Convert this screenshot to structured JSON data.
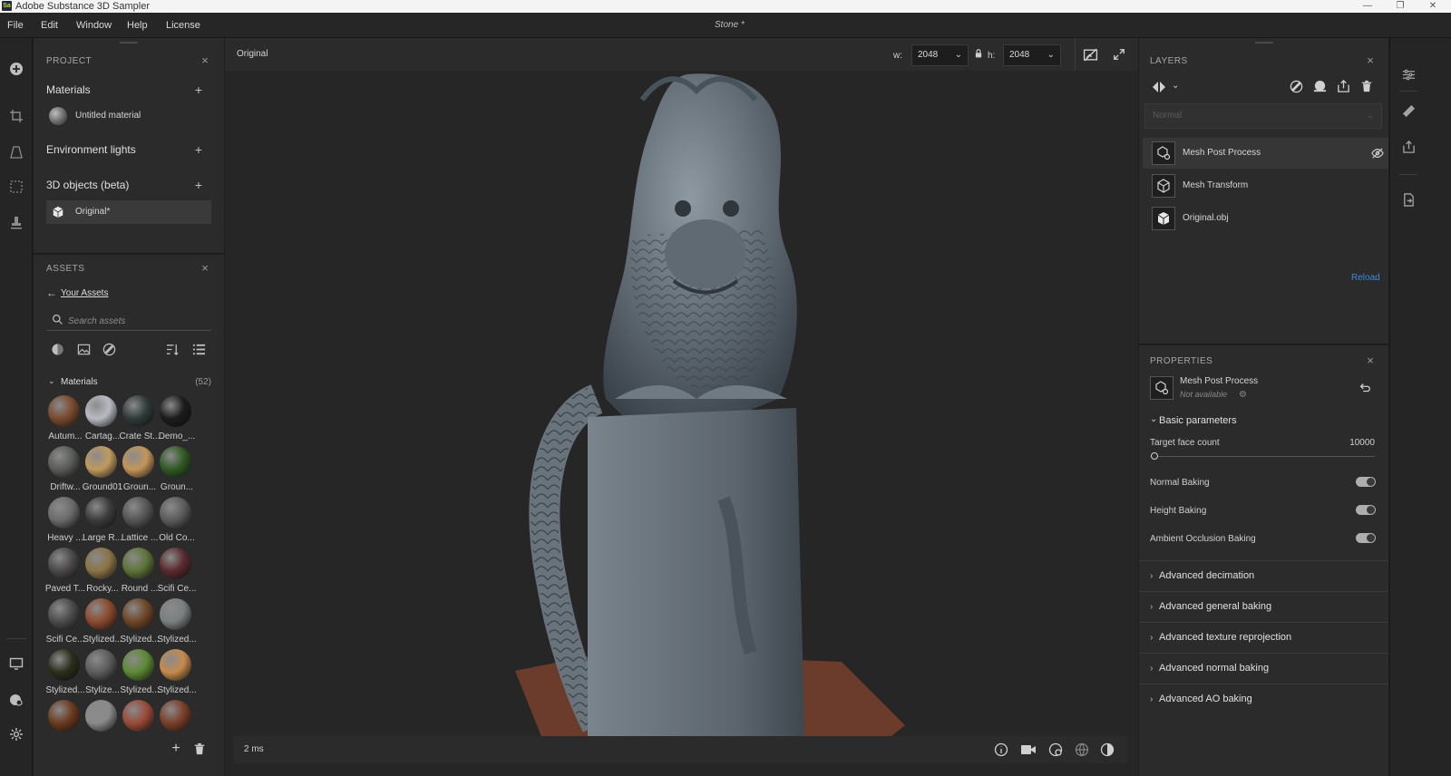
{
  "titlebar": {
    "app_icon": "Sa",
    "title": "Adobe Substance 3D Sampler",
    "min": "—",
    "max": "❐",
    "close": "✕"
  },
  "menu": [
    "File",
    "Edit",
    "Window",
    "Help",
    "License"
  ],
  "document_title": "Stone *",
  "project": {
    "title": "PROJECT",
    "materials_header": "Materials",
    "material_item": "Untitled material",
    "env_header": "Environment lights",
    "objects_header": "3D objects (beta)",
    "object_item": "Original*"
  },
  "assets": {
    "title": "ASSETS",
    "back_label": "Your Assets",
    "search_placeholder": "Search assets",
    "group_label": "Materials",
    "group_count": "(52)",
    "materials": [
      {
        "name": "Autum...",
        "color": "#7a4a2e"
      },
      {
        "name": "Cartag...",
        "color": "#b8bcc2"
      },
      {
        "name": "Crate St...",
        "color": "#2f3b3a"
      },
      {
        "name": "Demo_...",
        "color": "#1c1c1c"
      },
      {
        "name": "Driftw...",
        "color": "#5a5c59"
      },
      {
        "name": "Ground01",
        "color": "#c09a5e"
      },
      {
        "name": "Groun...",
        "color": "#c4955a"
      },
      {
        "name": "Groun...",
        "color": "#2f5a24"
      },
      {
        "name": "Heavy ...",
        "color": "#6b6b6b"
      },
      {
        "name": "Large R...",
        "color": "#3c3c3c"
      },
      {
        "name": "Lattice ...",
        "color": "#555555"
      },
      {
        "name": "Old Co...",
        "color": "#5c5c5c"
      },
      {
        "name": "Paved T...",
        "color": "#4a4848"
      },
      {
        "name": "Rocky...",
        "color": "#8a7346"
      },
      {
        "name": "Round ...",
        "color": "#5d7438"
      },
      {
        "name": "Scifi Ce...",
        "color": "#5a2a2e"
      },
      {
        "name": "Scifi Ce...",
        "color": "#4b4b4b"
      },
      {
        "name": "Stylized...",
        "color": "#8c4a2e"
      },
      {
        "name": "Stylized...",
        "color": "#6e4526"
      },
      {
        "name": "Stylized...",
        "color": "#7b7f80"
      },
      {
        "name": "Stylized...",
        "color": "#2a2d1a"
      },
      {
        "name": "Stylize...",
        "color": "#5c5c5c"
      },
      {
        "name": "Stylized...",
        "color": "#5c8a34"
      },
      {
        "name": "Stylized...",
        "color": "#c68a4c"
      },
      {
        "name": "",
        "color": "#6b3a1e"
      },
      {
        "name": "",
        "color": "#8a8a8a"
      },
      {
        "name": "",
        "color": "#9a4a38"
      },
      {
        "name": "",
        "color": "#7a3e2a"
      }
    ]
  },
  "viewport": {
    "label": "Original",
    "w_label": "w:",
    "w_value": "2048",
    "h_label": "h:",
    "h_value": "2048",
    "status": "2 ms"
  },
  "layers": {
    "title": "LAYERS",
    "blend_mode": "Normal",
    "items": [
      {
        "label": "Mesh Post Process"
      },
      {
        "label": "Mesh Transform"
      },
      {
        "label": "Original.obj"
      }
    ],
    "reload": "Reload"
  },
  "properties": {
    "title": "PROPERTIES",
    "node_name": "Mesh Post Process",
    "node_status": "Not available",
    "basic_header": "Basic parameters",
    "target_face_label": "Target face count",
    "target_face_value": "10000",
    "target_face_fraction": 0.02,
    "toggles": [
      {
        "label": "Normal Baking",
        "on": true
      },
      {
        "label": "Height Baking",
        "on": true
      },
      {
        "label": "Ambient Occlusion Baking",
        "on": true
      }
    ],
    "sections": [
      "Advanced decimation",
      "Advanced general baking",
      "Advanced texture reprojection",
      "Advanced normal baking",
      "Advanced AO baking"
    ]
  },
  "colors": {
    "accent_link": "#3a8bd8",
    "panel": "#2b2b2b",
    "viewport": "#262626"
  }
}
